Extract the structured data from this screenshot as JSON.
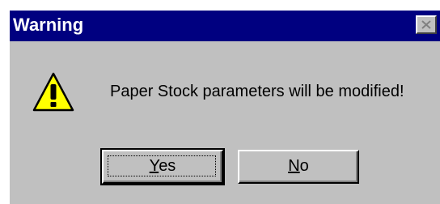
{
  "dialog": {
    "title": "Warning",
    "message": "Paper Stock parameters will be modified!",
    "icon": "warning-icon",
    "buttons": {
      "yes_label": "Yes",
      "no_label": "No"
    },
    "colors": {
      "titlebar": "#000080",
      "face": "#c0c0c0",
      "icon_fill": "#ffff00"
    }
  }
}
